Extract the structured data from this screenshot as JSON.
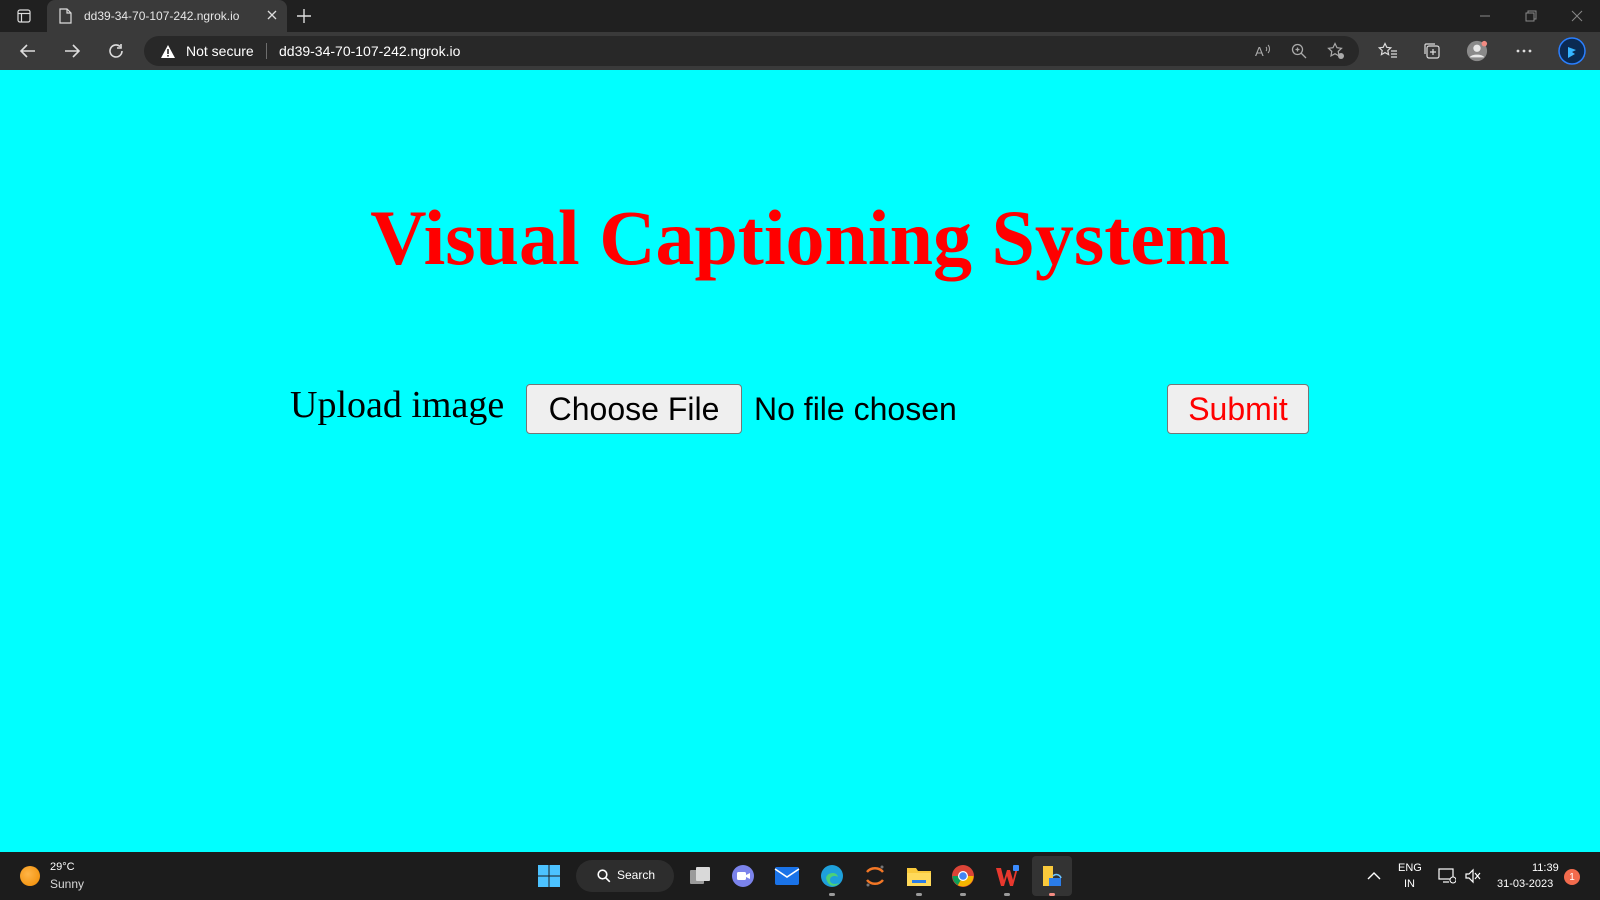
{
  "browser": {
    "tab": {
      "title": "dd39-34-70-107-242.ngrok.io"
    },
    "security_label": "Not secure",
    "url": "dd39-34-70-107-242.ngrok.io"
  },
  "page": {
    "title": "Visual Captioning System",
    "upload_label": "Upload image",
    "choose_file_label": "Choose File",
    "file_status": "No file chosen",
    "submit_label": "Submit"
  },
  "taskbar": {
    "weather": {
      "temp": "29°C",
      "condition": "Sunny"
    },
    "search_label": "Search",
    "language": {
      "line1": "ENG",
      "line2": "IN"
    },
    "clock": {
      "time": "11:39",
      "date": "31-03-2023"
    },
    "notification_count": "1"
  },
  "colors": {
    "page_background": "#00ffff",
    "title_color": "#ff0000",
    "submit_text_color": "#ff0000"
  }
}
